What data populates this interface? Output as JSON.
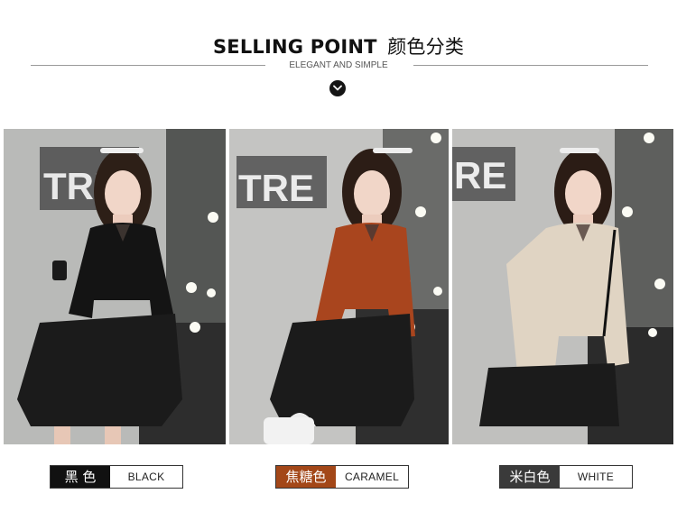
{
  "header": {
    "title_en": "SELLING POINT",
    "title_cn": "颜色分类",
    "subtitle": "ELEGANT AND SIMPLE",
    "expand_icon": "chevron-down-icon"
  },
  "sign_texts": [
    "TRE",
    "TRE",
    "RE"
  ],
  "colors": [
    {
      "cn": "黑 色",
      "en": "BLACK",
      "swatch": "#111111",
      "top_color": "#141414"
    },
    {
      "cn": "焦糖色",
      "en": "CARAMEL",
      "swatch": "#a34718",
      "top_color": "#a9451e"
    },
    {
      "cn": "米白色",
      "en": "WHITE",
      "swatch": "#3a3a3a",
      "top_color": "#e0d4c3"
    }
  ]
}
